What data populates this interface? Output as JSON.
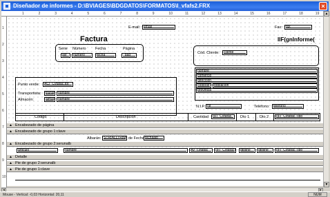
{
  "window": {
    "title": "Diseñador de informes - D:\\BVIAGES\\BDGDATOS\\FORMATOS\\I_vfafs2.FRX",
    "close_glyph": "×"
  },
  "ruler": {
    "h_labels": [
      "1",
      "2",
      "3",
      "4",
      "5",
      "6",
      "7",
      "8",
      "9",
      "10",
      "11",
      "12",
      "13",
      "14",
      "15",
      "16",
      "17",
      "18",
      "19"
    ],
    "v_labels": [
      "1",
      "2",
      "3",
      "4",
      "5",
      "6",
      "7",
      "8",
      "9",
      "10"
    ]
  },
  "header": {
    "email_label": "E-mail:",
    "email_field": "email",
    "fax_label": "Fax:",
    "fax_field": "fax",
    "title": "Factura",
    "iif_title": "IIF(gnInforme(",
    "invoice_box": {
      "columns": [
        "Serie",
        "Número",
        "Fecha",
        "Página"
      ],
      "fields": [
        "ser",
        "numero",
        "fecha",
        "_pag"
      ]
    },
    "client": {
      "code_label": "Cód. Cliente:",
      "code_field": "cliente",
      "fields": [
        "nombre",
        "comercio",
        "direccion",
        "codpost",
        "poblacion",
        "provincia"
      ],
      "nif_label": "N.I.F:",
      "nif_field": "nif",
      "phone_label": "Teléfono:",
      "phone_field": "telefono"
    },
    "left": {
      "green_label": "Punto verde:",
      "green_field": "AC(_Cvtafac.tot",
      "transport_label": "Transportista:",
      "transport_code": "transp",
      "transport_name": "nombre",
      "warehouse_label": "Almacén:",
      "warehouse_code": "almace",
      "warehouse_name": "nombre"
    },
    "columns": {
      "code": "Código",
      "description": "Descripción",
      "quantity": "Cantidad",
      "quantity_field": "IIF(_Cvtafac.",
      "dto1": "Dto 1",
      "dto2": "Dto 2",
      "last_field": "IIF(_Cvtafac.Tipo"
    }
  },
  "bands": {
    "page_header": "Encabezado de página",
    "group1_header": "Encabezado de grupo 1:clave",
    "albaran_label": "Albarán:",
    "albaran_field": "STR(ALLTRIM(",
    "albaran_date_label": "de Fecha:",
    "albaran_date_field": "fechaalb",
    "group2_header": "Encabezado de grupo 2:serunalb",
    "detail_fields": [
      "articulo",
      "nombre",
      "AV_t.vtafac",
      "IIF(_Cvtafac)",
      "dtoline",
      "dtoline",
      "IIF(_Cvtafac.Tipo"
    ],
    "detail": "Detalle",
    "group2_footer": "Pie de grupo 2:serunalb",
    "group1_footer": "Pie de grupo 1:clave"
  },
  "status": {
    "text": "Mouse - Vertical: -0,03   Horizontal: 20,11",
    "num": "NUM"
  }
}
